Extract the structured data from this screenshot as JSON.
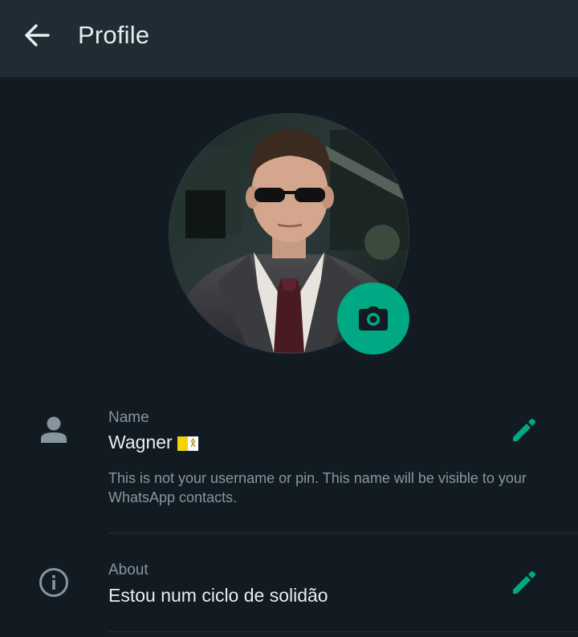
{
  "header": {
    "title": "Profile",
    "back_icon": "arrow-left-icon"
  },
  "profile_photo": {
    "camera_icon": "camera-icon"
  },
  "name_section": {
    "label": "Name",
    "value": "Wagner",
    "flag_icon": "vatican-flag-icon",
    "hint": "This is not your username or pin. This name will be visible to your WhatsApp contacts.",
    "icon": "person-icon",
    "edit_icon": "pencil-icon"
  },
  "about_section": {
    "label": "About",
    "value": "Estou num ciclo de solidão",
    "icon": "info-icon",
    "edit_icon": "pencil-icon"
  },
  "colors": {
    "background": "#121b22",
    "appbar": "#1f2c34",
    "accent": "#00a884",
    "primary_text": "#e9edef",
    "secondary_text": "#8696a0"
  }
}
